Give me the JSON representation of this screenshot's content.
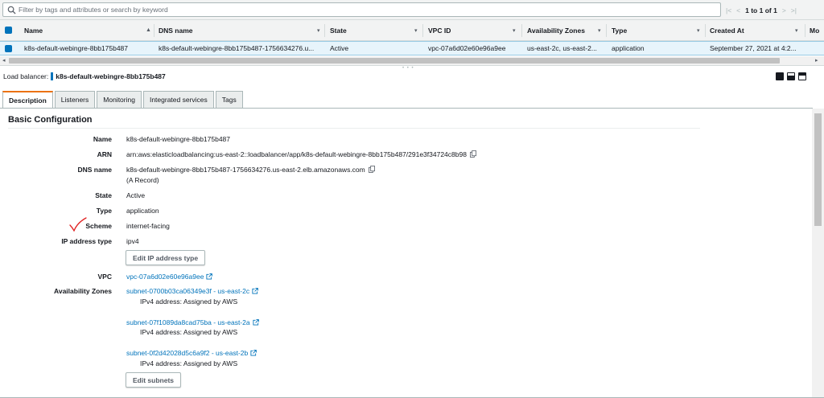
{
  "filter": {
    "placeholder": "Filter by tags and attributes or search by keyword"
  },
  "pager": {
    "text": "1 to 1 of 1",
    "first": "|<",
    "prev": "<",
    "next": ">",
    "last": ">|"
  },
  "table": {
    "columns": [
      "Name",
      "DNS name",
      "State",
      "VPC ID",
      "Availability Zones",
      "Type",
      "Created At",
      "Mo"
    ],
    "row": {
      "name": "k8s-default-webingre-8bb175b487",
      "dns": "k8s-default-webingre-8bb175b487-1756634276.u...",
      "state": "Active",
      "vpc": "vpc-07a6d02e60e96a9ee",
      "zones": "us-east-2c, us-east-2...",
      "type": "application",
      "created": "September 27, 2021 at 4:2..."
    }
  },
  "detail": {
    "prefix": "Load balancer:",
    "name": "k8s-default-webingre-8bb175b487",
    "tabs": [
      "Description",
      "Listeners",
      "Monitoring",
      "Integrated services",
      "Tags"
    ],
    "section_title": "Basic Configuration",
    "labels": {
      "name": "Name",
      "arn": "ARN",
      "dns": "DNS name",
      "state": "State",
      "type": "Type",
      "scheme": "Scheme",
      "ip_type": "IP address type",
      "vpc": "VPC",
      "zones": "Availability Zones"
    },
    "values": {
      "name": "k8s-default-webingre-8bb175b487",
      "arn": "arn:aws:elasticloadbalancing:us-east-2::loadbalancer/app/k8s-default-webingre-8bb175b487/291e3f34724c8b98",
      "dns": "k8s-default-webingre-8bb175b487-1756634276.us-east-2.elb.amazonaws.com",
      "dns_record": "(A Record)",
      "state": "Active",
      "type": "application",
      "scheme": "internet-facing",
      "ip_type": "ipv4",
      "vpc": "vpc-07a6d02e60e96a9ee"
    },
    "edit_ip_button": "Edit IP address type",
    "subnets": [
      {
        "link": "subnet-0700b03ca06349e3f - us-east-2c",
        "ipv4": "IPv4 address: Assigned by AWS"
      },
      {
        "link": "subnet-07f1089da8cad75ba - us-east-2a",
        "ipv4": "IPv4 address: Assigned by AWS"
      },
      {
        "link": "subnet-0f2d42028d5c6a9f2 - us-east-2b",
        "ipv4": "IPv4 address: Assigned by AWS"
      }
    ],
    "edit_subnets_button": "Edit subnets"
  },
  "colors": {
    "accent": "#0073bb",
    "tab_active": "#ec7211",
    "selected_row": "#e7f4fb",
    "annotation": "#e02020"
  }
}
